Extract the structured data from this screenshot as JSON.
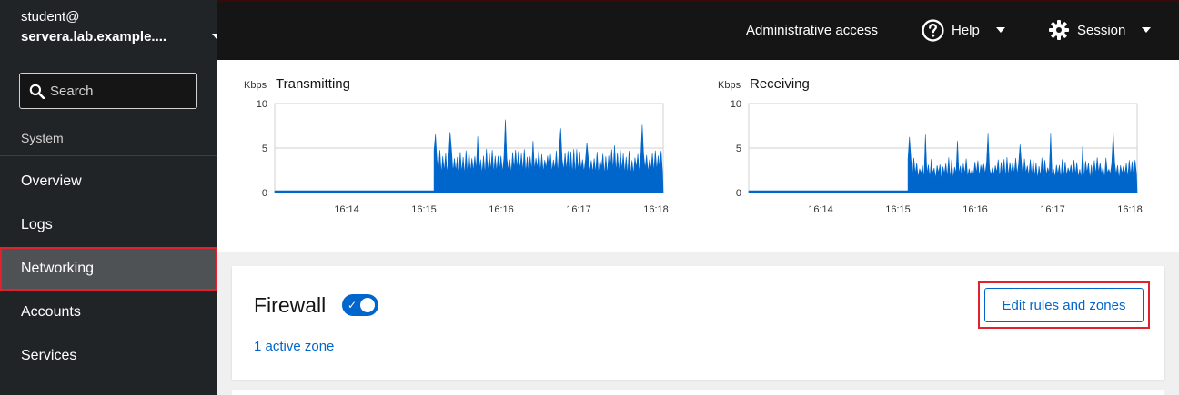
{
  "sidebar": {
    "host_user": "student@",
    "host_name": "servera.lab.example....",
    "search_placeholder": "Search",
    "section_label": "System",
    "items": [
      {
        "label": "Overview"
      },
      {
        "label": "Logs"
      },
      {
        "label": "Networking",
        "active": true
      },
      {
        "label": "Accounts"
      },
      {
        "label": "Services"
      }
    ]
  },
  "masthead": {
    "admin_access": "Administrative access",
    "help": "Help",
    "session": "Session"
  },
  "chart_data": [
    {
      "type": "area",
      "title": "Transmitting",
      "unit": "Kbps",
      "y_ticks": [
        "10",
        "5",
        "0"
      ],
      "ylim": [
        0,
        10
      ],
      "x_ticks": [
        "16:14",
        "16:15",
        "16:16",
        "16:17",
        "16:18"
      ],
      "color": "#0066cc",
      "idle_until_fraction": 0.41,
      "baseline": 0.2,
      "active_range": [
        3.6,
        4.9
      ],
      "spikes": [
        6.8,
        6.3,
        8.2,
        5.8,
        7.2,
        5.6,
        5.3,
        7.6
      ]
    },
    {
      "type": "area",
      "title": "Receiving",
      "unit": "Kbps",
      "y_ticks": [
        "10",
        "5",
        "0"
      ],
      "ylim": [
        0,
        10
      ],
      "x_ticks": [
        "16:14",
        "16:15",
        "16:16",
        "16:17",
        "16:18"
      ],
      "color": "#0066cc",
      "idle_until_fraction": 0.41,
      "baseline": 0.2,
      "active_range": [
        2.6,
        4.0
      ],
      "spikes": [
        6.5,
        5.8,
        6.6,
        5.4,
        6.6,
        5.2,
        6.7
      ]
    }
  ],
  "firewall": {
    "title": "Firewall",
    "enabled": true,
    "zones_link": "1 active zone",
    "edit_button": "Edit rules and zones"
  },
  "colors": {
    "accent": "#0066cc",
    "highlight": "#e0212e",
    "sidebar_bg": "#212427",
    "masthead_bg": "#151515"
  }
}
